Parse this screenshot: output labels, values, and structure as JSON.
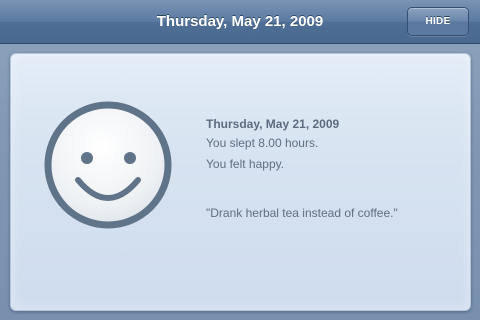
{
  "navbar": {
    "title": "Thursday, May 21, 2009",
    "hide_label": "HIDE"
  },
  "entry": {
    "date": "Thursday, May 21, 2009",
    "sleep": "You slept 8.00 hours.",
    "mood": "You felt happy.",
    "note": "\"Drank herbal tea instead of coffee.\"",
    "mood_icon": "happy-face-icon"
  },
  "colors": {
    "navbar": "#4e6e96",
    "card": "#d7e3f1",
    "face_outline": "#5f7389",
    "face_fill": "#f4f6f8",
    "text": "#5f6e82"
  }
}
